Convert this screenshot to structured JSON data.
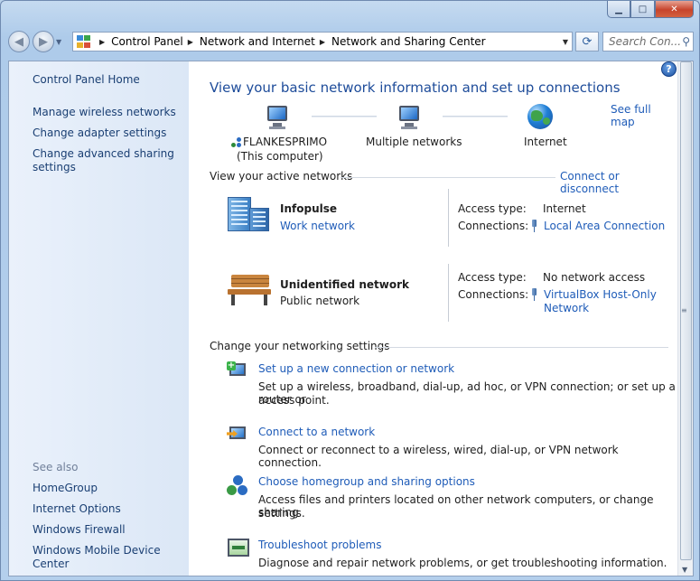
{
  "window": {
    "minimize_glyph": "▁",
    "maximize_glyph": "□",
    "close_glyph": "✕"
  },
  "nav": {
    "back_glyph": "◀",
    "forward_glyph": "▶",
    "breadcrumbs": [
      "Control Panel",
      "Network and Internet",
      "Network and Sharing Center"
    ],
    "search_placeholder": "Search Con...",
    "refresh_glyph": "⟳"
  },
  "sidebar": {
    "items": [
      "Control Panel Home",
      "Manage wireless networks",
      "Change adapter settings",
      "Change advanced sharing",
      "settings"
    ],
    "see_also_label": "See also",
    "see_also": [
      "HomeGroup",
      "Internet Options",
      "Windows Firewall",
      "Windows Mobile Device Center"
    ]
  },
  "main": {
    "title": "View your basic network information and set up connections",
    "see_full_map": "See full map",
    "map": {
      "computer_name": "FLANKESPRIMO",
      "computer_sub": "(This computer)",
      "middle": "Multiple networks",
      "internet": "Internet"
    },
    "active_networks_label": "View your active networks",
    "connect_or_disconnect": "Connect or disconnect",
    "networks": [
      {
        "name": "Infopulse",
        "type": "Work network",
        "access_label": "Access type:",
        "access_value": "Internet",
        "connections_label": "Connections:",
        "connection_line1": "Local Area Connection",
        "connection_line2": ""
      },
      {
        "name": "Unidentified network",
        "type": "Public network",
        "access_label": "Access type:",
        "access_value": "No network access",
        "connections_label": "Connections:",
        "connection_line1": "VirtualBox Host-Only",
        "connection_line2": "Network"
      }
    ],
    "change_settings_label": "Change your networking settings",
    "tasks": [
      {
        "link": "Set up a new connection or network",
        "desc1": "Set up a wireless, broadband, dial-up, ad hoc, or VPN connection; or set up a router or",
        "desc2": "access point."
      },
      {
        "link": "Connect to a network",
        "desc1": "Connect or reconnect to a wireless, wired, dial-up, or VPN network connection.",
        "desc2": ""
      },
      {
        "link": "Choose homegroup and sharing options",
        "desc1": "Access files and printers located on other network computers, or change sharing",
        "desc2": "settings."
      },
      {
        "link": "Troubleshoot problems",
        "desc1": "Diagnose and repair network problems, or get troubleshooting information.",
        "desc2": ""
      }
    ],
    "help_glyph": "?"
  },
  "colors": {
    "link": "#1f5cb8",
    "title": "#1e4c9a",
    "sidebar_link": "#1a3f73"
  }
}
